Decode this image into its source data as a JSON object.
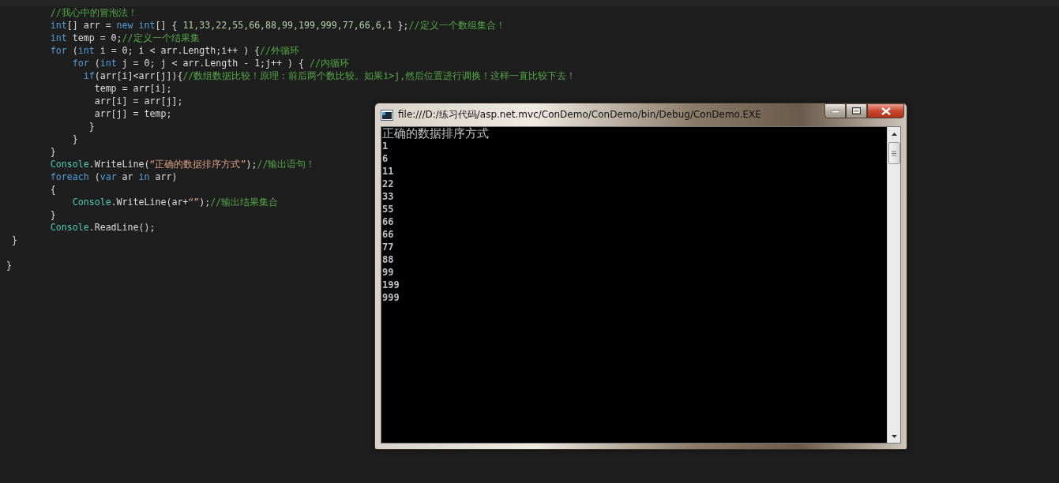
{
  "editor": {
    "lines": [
      {
        "kind": "code",
        "segments": [
          {
            "kind": "comment",
            "text": "        //我心中的冒泡法！"
          }
        ]
      },
      {
        "kind": "code",
        "segments": [
          {
            "kind": "keyword",
            "text": "        int"
          },
          {
            "kind": "plain",
            "text": "[] arr = "
          },
          {
            "kind": "keyword",
            "text": "new "
          },
          {
            "kind": "keyword",
            "text": "int"
          },
          {
            "kind": "plain",
            "text": "[] { "
          },
          {
            "kind": "number",
            "text": "11,33,22,55,66,88,99,199,999,77,66,6,1"
          },
          {
            "kind": "plain",
            "text": " };"
          },
          {
            "kind": "comment",
            "text": "//定义一个数组集合！"
          }
        ]
      },
      {
        "kind": "code",
        "segments": [
          {
            "kind": "keyword",
            "text": "        int"
          },
          {
            "kind": "plain",
            "text": " temp = 0;"
          },
          {
            "kind": "comment",
            "text": "//定义一个结果集"
          }
        ]
      },
      {
        "kind": "code",
        "segments": [
          {
            "kind": "keyword",
            "text": "        for"
          },
          {
            "kind": "plain",
            "text": " ("
          },
          {
            "kind": "keyword",
            "text": "int"
          },
          {
            "kind": "plain",
            "text": " i = 0; i < arr.Length;i++ ) {"
          },
          {
            "kind": "comment",
            "text": "//外循环"
          }
        ]
      },
      {
        "kind": "code",
        "segments": [
          {
            "kind": "keyword",
            "text": "            for"
          },
          {
            "kind": "plain",
            "text": " ("
          },
          {
            "kind": "keyword",
            "text": "int"
          },
          {
            "kind": "plain",
            "text": " j = 0; j < arr.Length - 1;j++ ) { "
          },
          {
            "kind": "comment",
            "text": "//内循环"
          }
        ]
      },
      {
        "kind": "code",
        "segments": [
          {
            "kind": "keyword",
            "text": "              if"
          },
          {
            "kind": "plain",
            "text": "(arr[i]<arr[j]){"
          },
          {
            "kind": "comment",
            "text": "//数组数据比较！原理：前后两个数比较。如果i>j,然后位置进行调换！这样一直比较下去！"
          }
        ]
      },
      {
        "kind": "code",
        "segments": [
          {
            "kind": "plain",
            "text": "                temp = arr[i];"
          }
        ]
      },
      {
        "kind": "code",
        "segments": [
          {
            "kind": "plain",
            "text": "                arr[i] = arr[j];"
          }
        ]
      },
      {
        "kind": "code",
        "segments": [
          {
            "kind": "plain",
            "text": "                arr[j] = temp;"
          }
        ]
      },
      {
        "kind": "code",
        "segments": [
          {
            "kind": "plain",
            "text": "               }"
          }
        ]
      },
      {
        "kind": "code",
        "segments": [
          {
            "kind": "plain",
            "text": "            }"
          }
        ]
      },
      {
        "kind": "code",
        "segments": [
          {
            "kind": "plain",
            "text": "        }"
          }
        ]
      },
      {
        "kind": "code",
        "segments": [
          {
            "kind": "type",
            "text": "        Console"
          },
          {
            "kind": "plain",
            "text": ".WriteLine("
          },
          {
            "kind": "string",
            "text": "“正确的数据排序方式”"
          },
          {
            "kind": "plain",
            "text": ");"
          },
          {
            "kind": "comment",
            "text": "//输出语句！"
          }
        ]
      },
      {
        "kind": "code",
        "segments": [
          {
            "kind": "keyword",
            "text": "        foreach"
          },
          {
            "kind": "plain",
            "text": " ("
          },
          {
            "kind": "keyword",
            "text": "var"
          },
          {
            "kind": "plain",
            "text": " ar "
          },
          {
            "kind": "keyword",
            "text": "in"
          },
          {
            "kind": "plain",
            "text": " arr)"
          }
        ]
      },
      {
        "kind": "code",
        "segments": [
          {
            "kind": "plain",
            "text": "        {"
          }
        ]
      },
      {
        "kind": "code",
        "segments": [
          {
            "kind": "type",
            "text": "            Console"
          },
          {
            "kind": "plain",
            "text": ".WriteLine(ar+"
          },
          {
            "kind": "string",
            "text": "“”"
          },
          {
            "kind": "plain",
            "text": ");"
          },
          {
            "kind": "comment",
            "text": "//输出结果集合"
          }
        ]
      },
      {
        "kind": "code",
        "segments": [
          {
            "kind": "plain",
            "text": "        }"
          }
        ]
      },
      {
        "kind": "code",
        "segments": [
          {
            "kind": "type",
            "text": "        Console"
          },
          {
            "kind": "plain",
            "text": ".ReadLine();"
          }
        ]
      },
      {
        "kind": "code",
        "segments": [
          {
            "kind": "plain",
            "text": " }"
          }
        ]
      },
      {
        "kind": "blank"
      },
      {
        "kind": "code",
        "segments": [
          {
            "kind": "plain",
            "text": "}"
          }
        ]
      }
    ]
  },
  "console": {
    "title": "file:///D:/练习代码/asp.net.mvc/ConDemo/ConDemo/bin/Debug/ConDemo.EXE",
    "output": [
      "正确的数据排序方式",
      "1",
      "6",
      "11",
      "22",
      "33",
      "55",
      "66",
      "66",
      "77",
      "88",
      "99",
      "199",
      "999"
    ]
  }
}
